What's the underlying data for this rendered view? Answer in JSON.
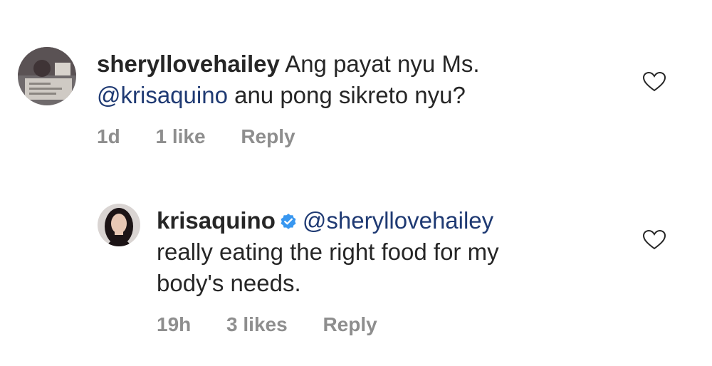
{
  "comments": [
    {
      "username": "sheryllovehailey",
      "text_line1": "Ang payat nyu Ms.",
      "mention": "@krisaquino",
      "text_line2_rest": "anu pong sikreto nyu?",
      "time": "1d",
      "likes": "1 like",
      "reply": "Reply",
      "avatar_icon": "user-avatar",
      "like_icon": "heart-outline-icon"
    },
    {
      "username": "krisaquino",
      "verified_icon": "verified-badge-icon",
      "mention": "@sheryllovehailey",
      "text_line2": "really eating the right food for my",
      "text_line3": "body's needs.",
      "time": "19h",
      "likes": "3 likes",
      "reply": "Reply",
      "avatar_icon": "user-avatar",
      "like_icon": "heart-outline-icon"
    }
  ],
  "colors": {
    "text": "#262626",
    "meta": "#8e8e8e",
    "mention": "#1f3a73",
    "verified": "#3897f0"
  }
}
